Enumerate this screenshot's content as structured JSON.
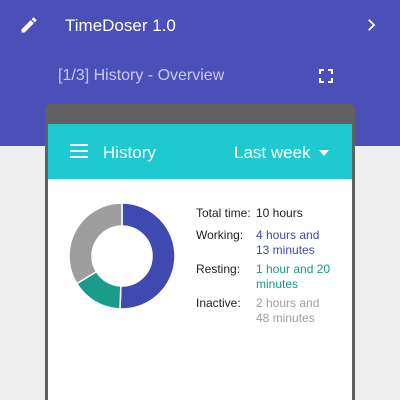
{
  "app": {
    "title": "TimeDoser 1.0",
    "subtitle": "[1/3] History - Overview",
    "icons": {
      "edit": "pencil-icon",
      "next": "chevron-right-icon",
      "fullscreen": "fullscreen-icon"
    }
  },
  "card": {
    "title": "History",
    "range": "Last week",
    "icons": {
      "menu": "hamburger-menu-icon",
      "dropdown": "dropdown-arrow-icon"
    }
  },
  "stats": {
    "total": {
      "label": "Total time:",
      "value": "10 hours"
    },
    "working": {
      "label": "Working:",
      "value": "4 hours and 13 minutes",
      "fraction": 0.42,
      "color": "#3f4ab0"
    },
    "resting": {
      "label": "Resting:",
      "value": "1 hour and 20 minutes",
      "fraction": 0.13,
      "color": "#1a9c8a"
    },
    "inactive": {
      "label": "Inactive:",
      "value": "2 hours and 48 minutes",
      "fraction": 0.28,
      "color": "#9e9e9e"
    }
  },
  "colors": {
    "appbar": "#4a50b8",
    "toolbar": "#1ec9cf",
    "background": "#efefef"
  }
}
